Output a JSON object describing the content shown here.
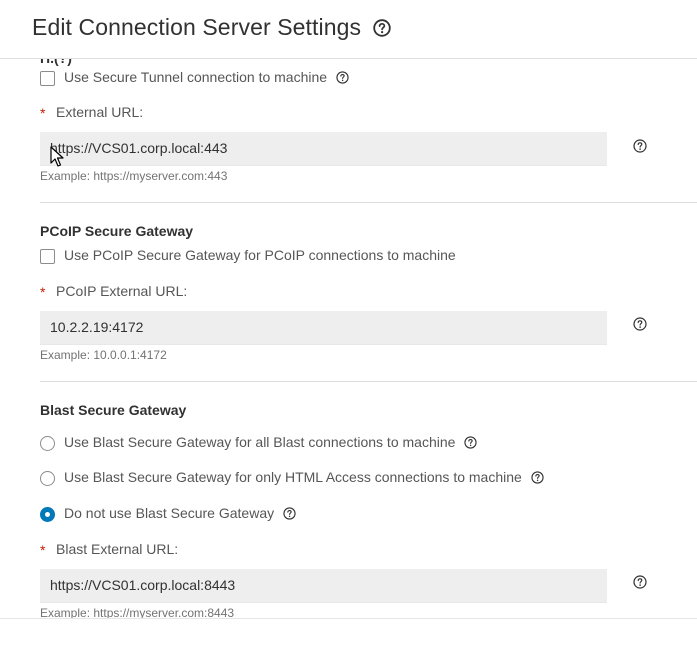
{
  "dialog": {
    "title": "Edit Connection Server Settings",
    "clipped_heading": "H.(?)"
  },
  "secure_tunnel": {
    "checkbox_label": "Use Secure Tunnel connection to machine",
    "checked": false,
    "url_label": "External URL:",
    "url_value": "https://VCS01.corp.local:443",
    "example": "Example: https://myserver.com:443"
  },
  "pcoip": {
    "heading": "PCoIP Secure Gateway",
    "checkbox_label": "Use PCoIP Secure Gateway for PCoIP connections to machine",
    "checked": false,
    "url_label": "PCoIP External URL:",
    "url_value": "10.2.2.19:4172",
    "example": "Example: 10.0.0.1:4172"
  },
  "blast": {
    "heading": "Blast Secure Gateway",
    "options": [
      {
        "label": "Use Blast Secure Gateway for all Blast connections to machine",
        "selected": false
      },
      {
        "label": "Use Blast Secure Gateway for only HTML Access connections to machine",
        "selected": false
      },
      {
        "label": "Do not use Blast Secure Gateway",
        "selected": true
      }
    ],
    "url_label": "Blast External URL:",
    "url_value": "https://VCS01.corp.local:8443",
    "example": "Example: https://myserver.com:8443"
  },
  "required_marker": "*",
  "colors": {
    "accent": "#0079b8",
    "required": "#c21d00",
    "input_bg": "#eeeeee"
  },
  "icons": [
    "help-circle-icon",
    "mouse-pointer-icon"
  ]
}
